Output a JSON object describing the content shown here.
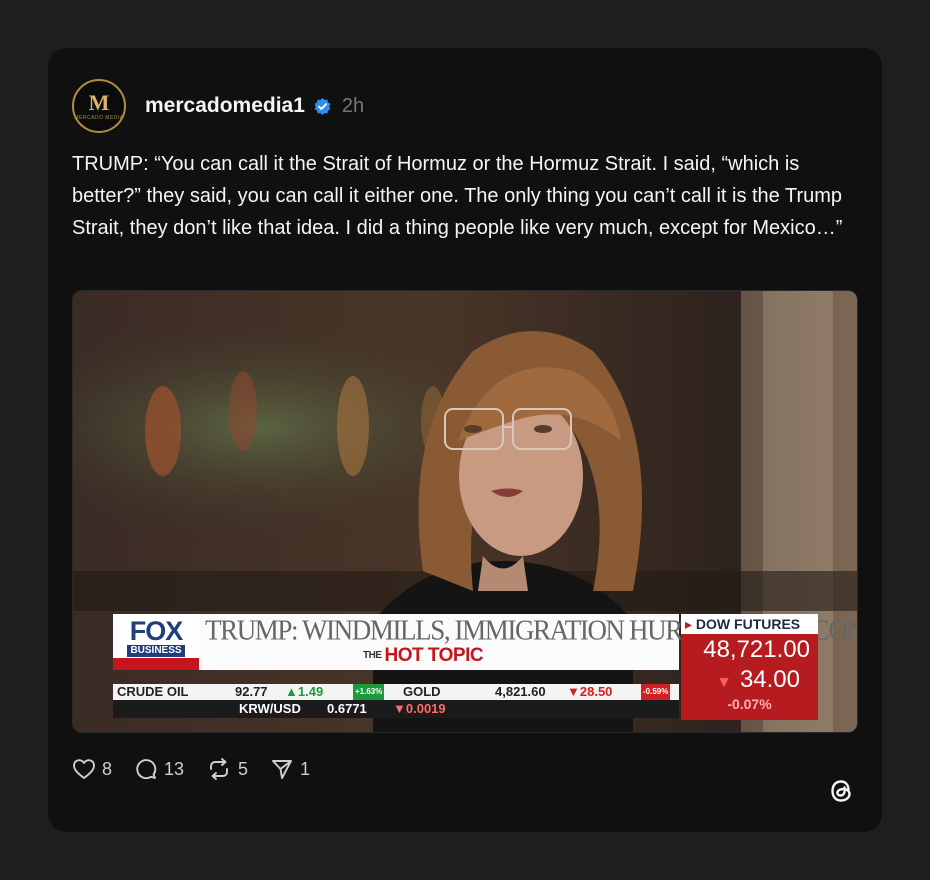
{
  "post": {
    "username": "mercadomedia1",
    "time": "2h",
    "avatar_initial": "M",
    "avatar_subtext": "MERCADO MEDIA",
    "text": "TRUMP: “You can call it the Strait of Hormuz or the Hormuz Strait. I said, “which is better?” they said, you can call it either one. The only thing you can’t call it is the Trump Strait, they don’t like that idea. I did a thing people like very much, except for Mexico…”",
    "verified_icon": "verified-badge-icon"
  },
  "video": {
    "logo_top": "FOX",
    "logo_bottom": "BUSINESS",
    "headline": "TRUMP: WINDMILLS, IMMIGRATION HURTING U.K. ECONOMY",
    "hot_topic_prefix": "THE",
    "hot_topic": "HOT TOPIC",
    "dow_label": "DOW FUTURES",
    "dow_value": "48,721.00",
    "dow_change": "34.00",
    "dow_pct": "-0.07%",
    "ticker1": {
      "crude_label": "CRUDE OIL",
      "crude_price": "92.77",
      "crude_change": "▲1.49",
      "crude_pct": "+1.63%",
      "gold_label": "GOLD",
      "gold_price": "4,821.60",
      "gold_change": "▼28.50",
      "gold_pct": "-0.59%"
    },
    "ticker2": {
      "pair": "KRW/USD",
      "price": "0.6771",
      "change": "▼0.0019"
    }
  },
  "actions": {
    "likes": "8",
    "replies": "13",
    "reposts": "5",
    "shares": "1"
  },
  "colors": {
    "background": "#1e1e1e",
    "card": "#101010",
    "verified": "#2f8cf0",
    "fox_red": "#c4161c",
    "fox_blue": "#1f3e7a"
  },
  "icons": [
    "heart-icon",
    "comment-icon",
    "repost-icon",
    "share-icon",
    "threads-logo-icon"
  ]
}
